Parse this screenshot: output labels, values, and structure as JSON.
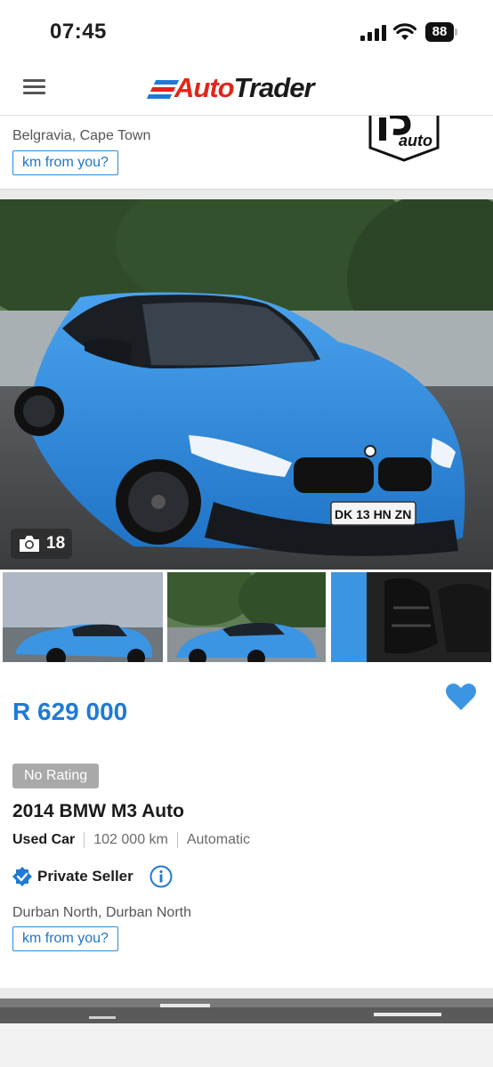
{
  "status_bar": {
    "time": "07:45",
    "battery": "88"
  },
  "header": {
    "brand_part1": "Auto",
    "brand_part2": "Trader"
  },
  "previous_listing": {
    "location": "Belgravia, Cape Town",
    "distance_button": "km from you?"
  },
  "listing": {
    "photo_count": "18",
    "price": "R 629 000",
    "rating": "No Rating",
    "title": "2014 BMW M3 Auto",
    "condition": "Used Car",
    "mileage": "102 000 km",
    "transmission": "Automatic",
    "seller_type": "Private Seller",
    "location": "Durban North, Durban North",
    "distance_button": "km from you?",
    "plate_text": "DK 13 HN ZN"
  },
  "colors": {
    "accent": "#1f7ad6",
    "brand_red": "#e1251b",
    "car_blue": "#2e8fe0"
  }
}
